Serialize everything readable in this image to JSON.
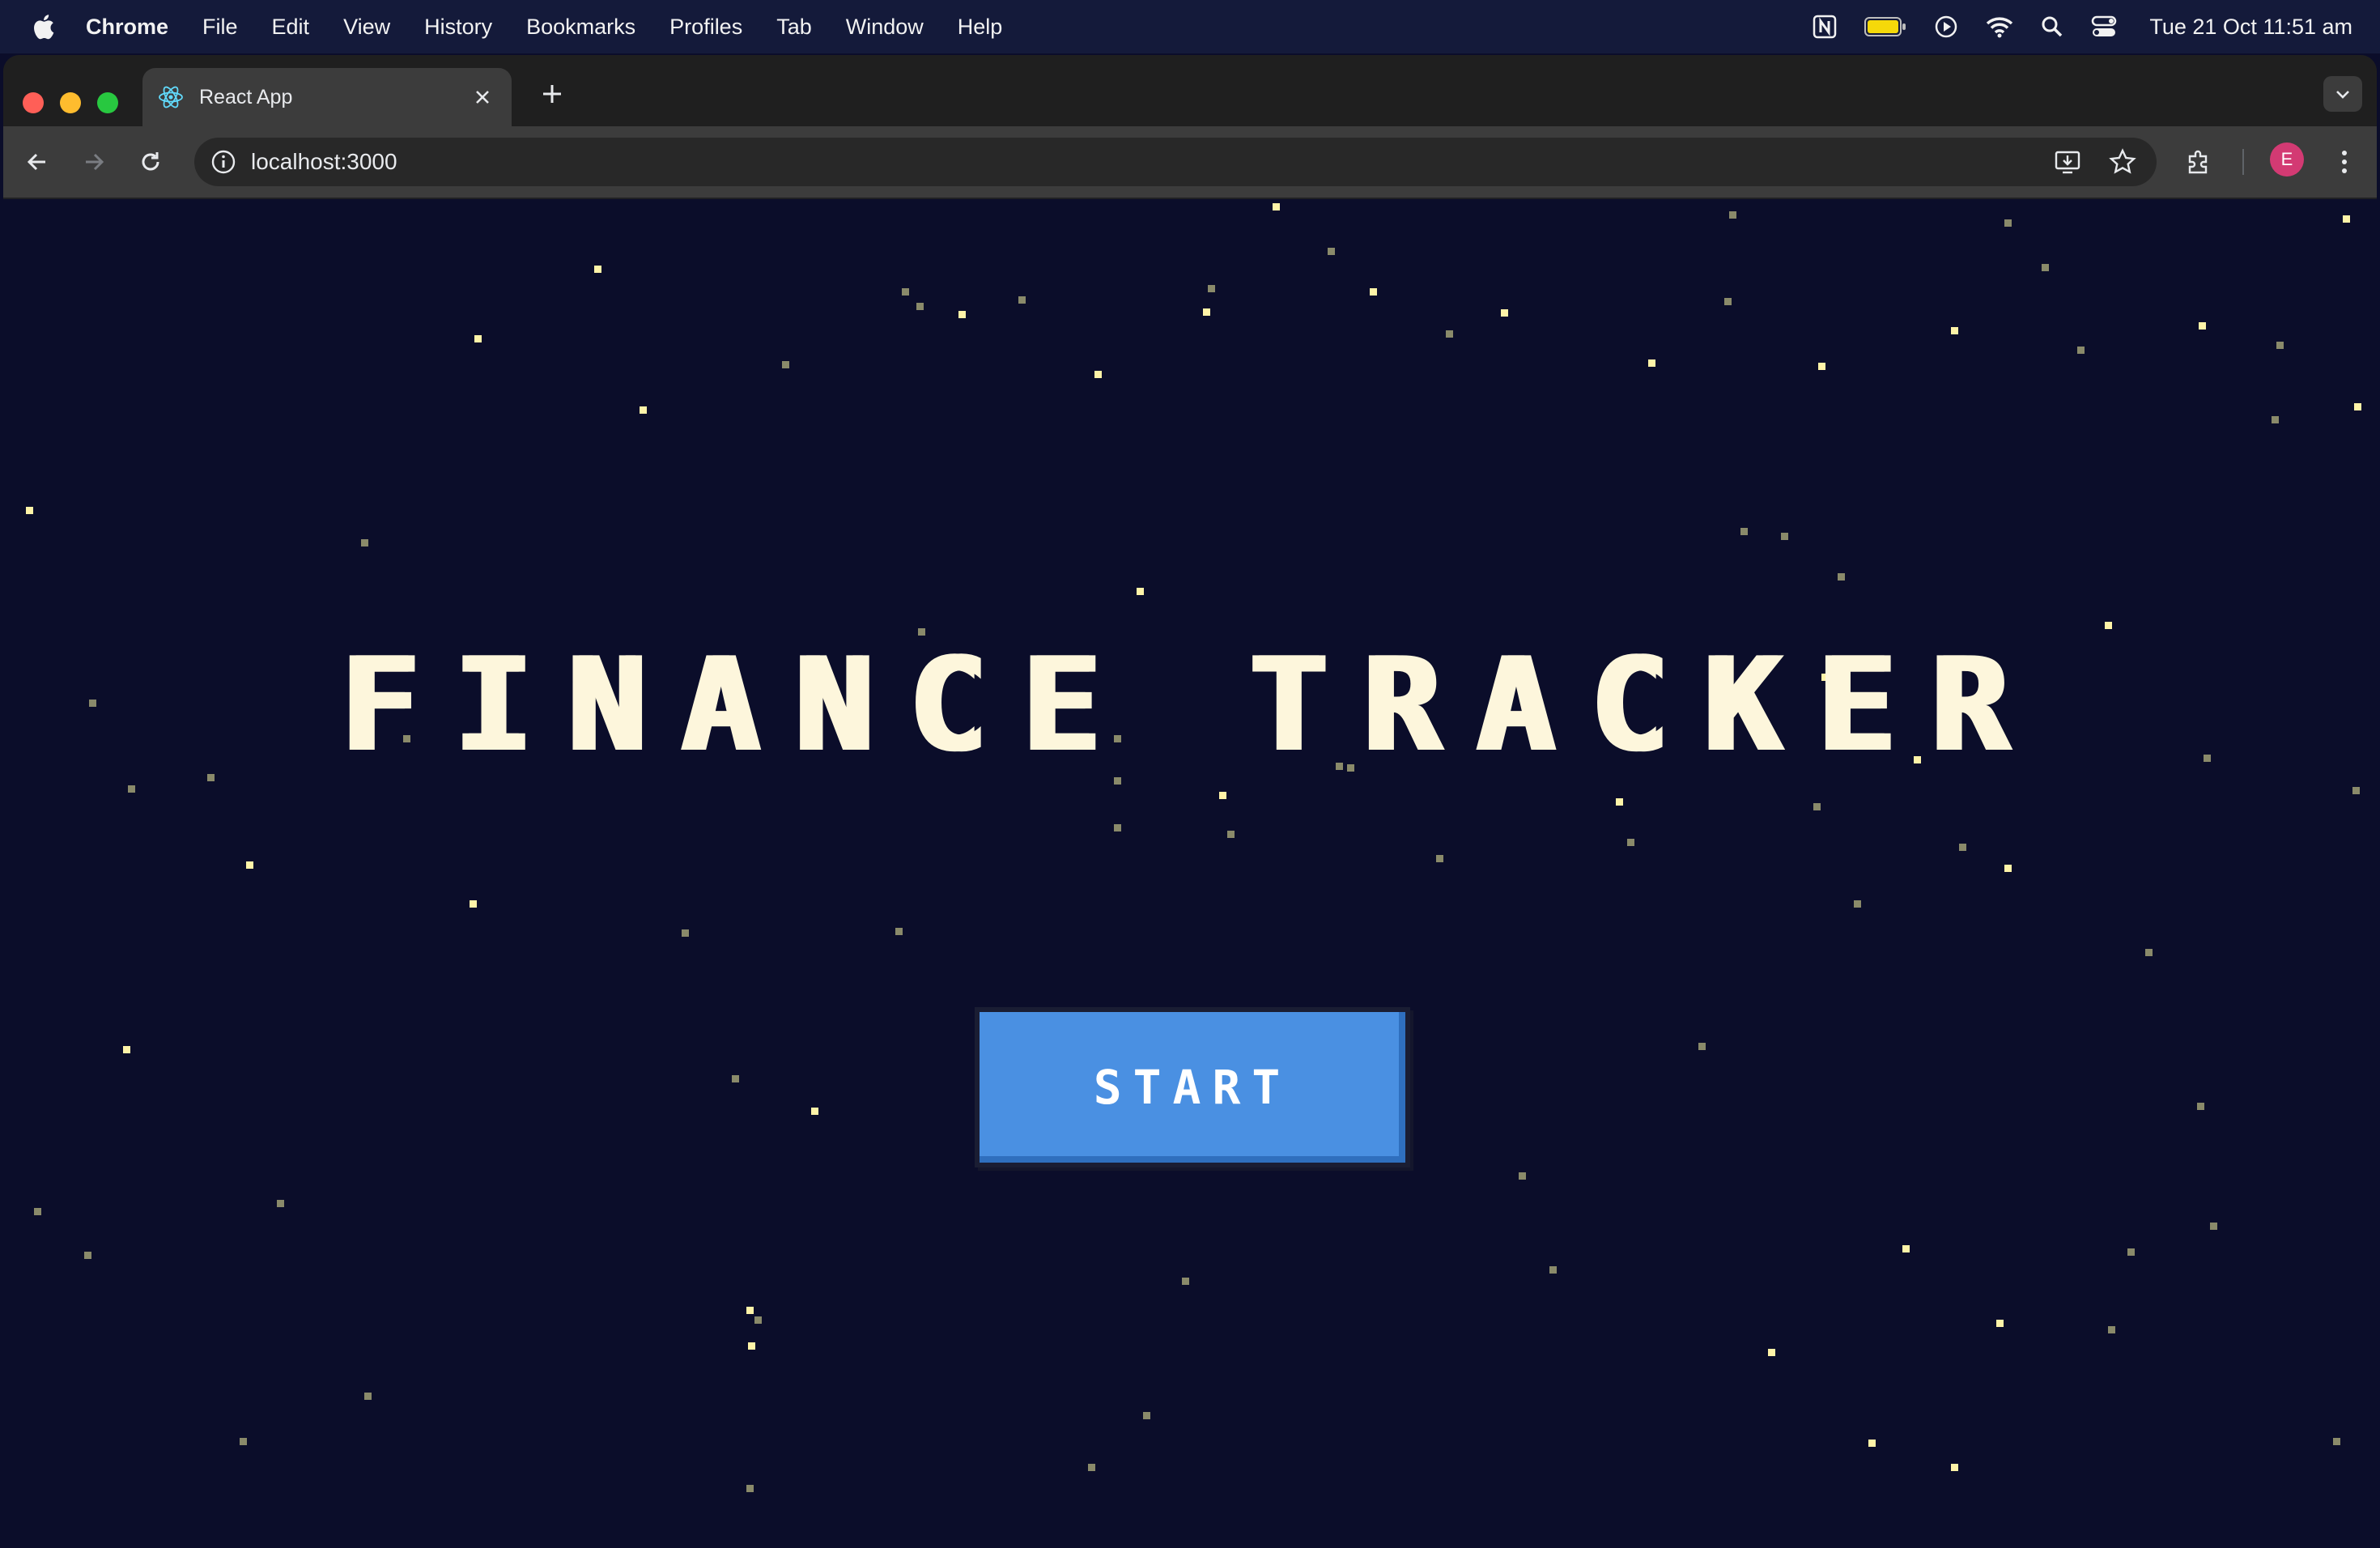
{
  "menubar": {
    "app_name": "Chrome",
    "items": [
      "File",
      "Edit",
      "View",
      "History",
      "Bookmarks",
      "Profiles",
      "Tab",
      "Window",
      "Help"
    ],
    "clock": "Tue 21 Oct  11:51 am",
    "status_icons": [
      "notion-icon",
      "battery-icon",
      "play-icon",
      "wifi-icon",
      "search-icon",
      "control-center-icon"
    ]
  },
  "browser": {
    "tab_title": "React App",
    "url": "localhost:3000",
    "profile_initial": "E"
  },
  "page": {
    "title": "FINANCE TRACKER",
    "start_label": "START"
  },
  "colors": {
    "background": "#0b0d2a",
    "title": "#fdf6dc",
    "button": "#4a90e2",
    "star_bright": "#fff3a8",
    "star_dim": "#8a8a6a"
  }
}
